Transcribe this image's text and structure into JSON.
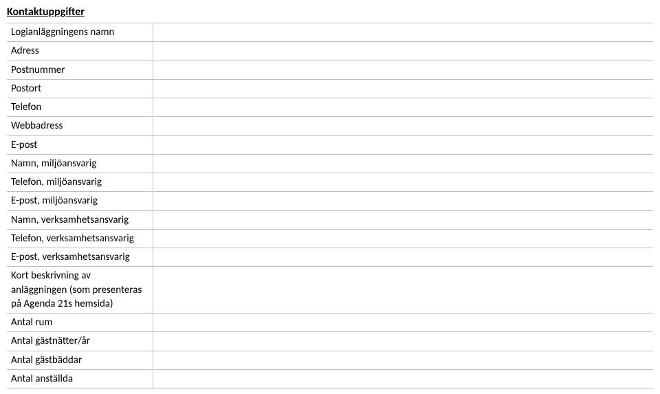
{
  "heading": "Kontaktuppgifter",
  "rows": [
    {
      "label": "Logianläggningens namn",
      "value": ""
    },
    {
      "label": "Adress",
      "value": ""
    },
    {
      "label": "Postnummer",
      "value": ""
    },
    {
      "label": "Postort",
      "value": ""
    },
    {
      "label": "Telefon",
      "value": ""
    },
    {
      "label": "Webbadress",
      "value": ""
    },
    {
      "label": "E-post",
      "value": ""
    },
    {
      "label": "Namn, miljöansvarig",
      "value": ""
    },
    {
      "label": "Telefon, miljöansvarig",
      "value": ""
    },
    {
      "label": "E-post, miljöansvarig",
      "value": ""
    },
    {
      "label": "Namn, verksamhetsansvarig",
      "value": ""
    },
    {
      "label": "Telefon, verksamhetsansvarig",
      "value": ""
    },
    {
      "label": "E-post, verksamhetsansvarig",
      "value": ""
    },
    {
      "label": "Kort beskrivning av anläggningen (som presenteras på Agenda 21s hemsida)",
      "value": "",
      "tall": true
    },
    {
      "label": "Antal rum",
      "value": ""
    },
    {
      "label": "Antal gästnätter/år",
      "value": ""
    },
    {
      "label": "Antal gästbäddar",
      "value": ""
    },
    {
      "label": "Antal anställda",
      "value": ""
    }
  ]
}
